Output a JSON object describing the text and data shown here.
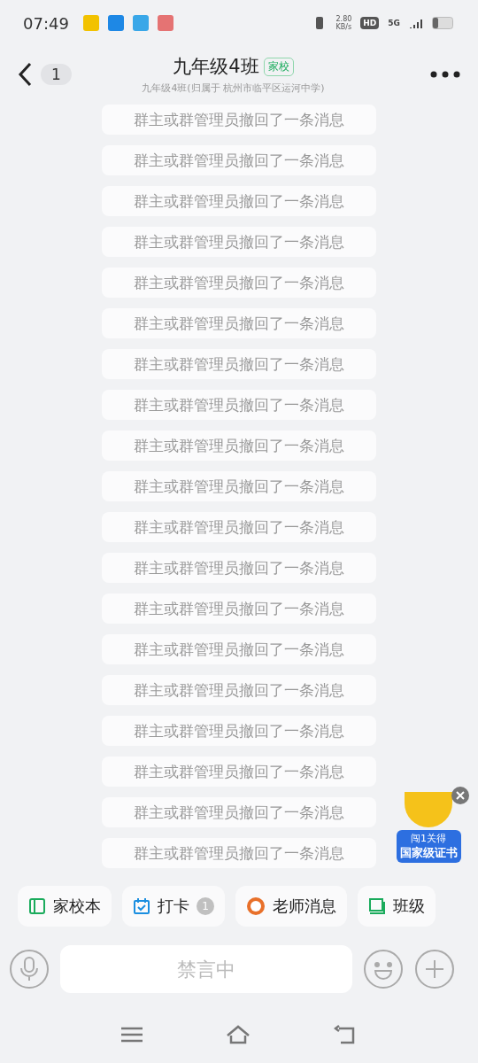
{
  "status_bar": {
    "time": "07:49",
    "speed_value": "2.80",
    "speed_unit": "KB/s",
    "hd": "HD",
    "network": "5G"
  },
  "header": {
    "back_count": "1",
    "title": "九年级4班",
    "tag": "家校",
    "subtitle": "九年级4班(归属于 杭州市临平区运河中学)"
  },
  "messages": [
    "群主或群管理员撤回了一条消息",
    "群主或群管理员撤回了一条消息",
    "群主或群管理员撤回了一条消息",
    "群主或群管理员撤回了一条消息",
    "群主或群管理员撤回了一条消息",
    "群主或群管理员撤回了一条消息",
    "群主或群管理员撤回了一条消息",
    "群主或群管理员撤回了一条消息",
    "群主或群管理员撤回了一条消息",
    "群主或群管理员撤回了一条消息",
    "群主或群管理员撤回了一条消息",
    "群主或群管理员撤回了一条消息",
    "群主或群管理员撤回了一条消息",
    "群主或群管理员撤回了一条消息",
    "群主或群管理员撤回了一条消息",
    "群主或群管理员撤回了一条消息",
    "群主或群管理员撤回了一条消息",
    "群主或群管理员撤回了一条消息",
    "群主或群管理员撤回了一条消息"
  ],
  "promo": {
    "line1": "闯1关得",
    "line2": "国家级证书"
  },
  "shortcuts": [
    {
      "kind": "notebook",
      "label": "家校本"
    },
    {
      "kind": "calendar",
      "label": "打卡",
      "badge": "1"
    },
    {
      "kind": "teacher",
      "label": "老师消息"
    },
    {
      "kind": "book",
      "label": "班级"
    }
  ],
  "input": {
    "placeholder": "禁言中"
  }
}
